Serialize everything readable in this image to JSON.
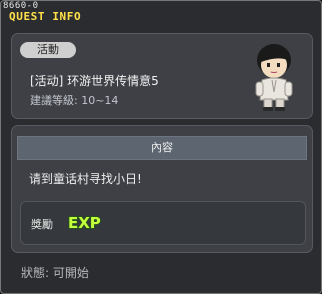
{
  "window": {
    "id_text": "8660-0",
    "title": "QUEST INFO"
  },
  "quest": {
    "tag": "活動",
    "name": "[活动] 环游世界传情意5",
    "level": "建議等級: 10~14"
  },
  "content": {
    "header": "內容",
    "text": "请到童话村寻找小日!"
  },
  "reward": {
    "label": "獎勵",
    "badge": "EXP"
  },
  "status": "狀態: 可開始",
  "colors": {
    "title": "#ffe24a",
    "exp_fill": "#c6ff3e",
    "exp_outline": "#1e5b12"
  }
}
